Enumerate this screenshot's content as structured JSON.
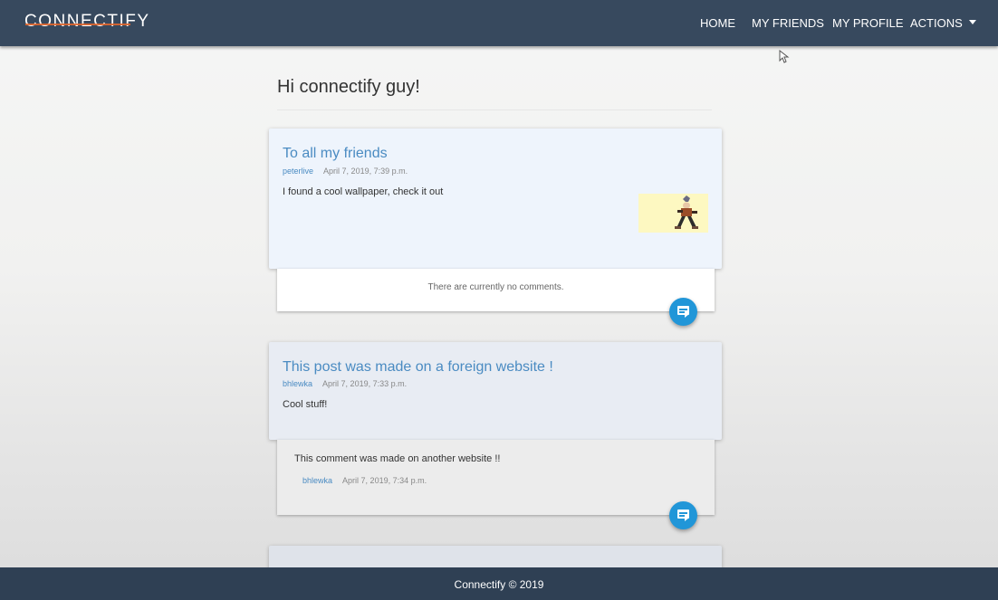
{
  "navbar": {
    "brand": "CONNECTIFY",
    "links": [
      {
        "label": "HOME"
      },
      {
        "label": "MY FRIENDS"
      },
      {
        "label": "MY PROFILE"
      },
      {
        "label": "ACTIONS"
      }
    ]
  },
  "greeting": "Hi connectify guy!",
  "posts": [
    {
      "title": "To all my friends",
      "author": "peterlive",
      "date": "April 7, 2019, 7:39 p.m.",
      "body": "I found a cool wallpaper, check it out",
      "has_image": true,
      "no_comments_text": "There are currently no comments."
    },
    {
      "title": "This post was made on a foreign website !",
      "author": "bhlewka",
      "date": "April 7, 2019, 7:33 p.m.",
      "body": "Cool stuff!",
      "comments": [
        {
          "text": "This comment was made on another website !!",
          "author": "bhlewka",
          "date": "April 7, 2019, 7:34 p.m."
        }
      ]
    }
  ],
  "footer": "Connectify © 2019",
  "colors": {
    "navbar": "#37495e",
    "footer": "#2f4054",
    "link_blue": "#4a8bc2",
    "fab_blue": "#2196d8",
    "brand_accent": "#e0662e"
  },
  "icons": [
    "caret-down-icon",
    "comment-icon",
    "mouse-cursor-icon"
  ]
}
